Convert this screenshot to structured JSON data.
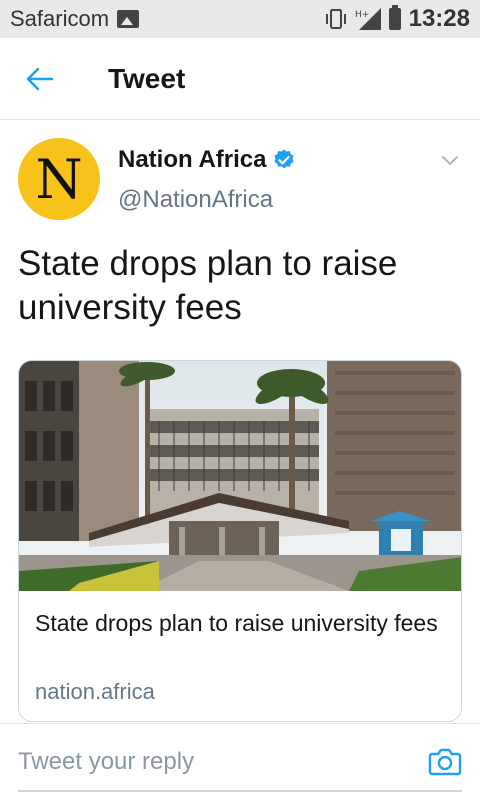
{
  "status_bar": {
    "carrier": "Safaricom",
    "network_type": "H+",
    "time": "13:28",
    "icons": [
      "image-icon",
      "vibrate-icon",
      "signal-icon",
      "battery-icon"
    ]
  },
  "app_bar": {
    "title": "Tweet",
    "back_icon": "arrow-left-icon"
  },
  "tweet": {
    "author_name": "Nation Africa",
    "author_handle": "@NationAfrica",
    "avatar_letter": "N",
    "verified": true,
    "text": "State drops plan to raise university fees",
    "card": {
      "title": "State drops plan to raise university fees",
      "domain": "nation.africa"
    }
  },
  "reply": {
    "placeholder": "Tweet your reply",
    "camera_icon": "camera-icon"
  },
  "colors": {
    "accent": "#1da1f2",
    "avatar_bg": "#f7c21a",
    "text_primary": "#14171a",
    "text_secondary": "#657786",
    "status_bar_bg": "#e9e9e9"
  }
}
